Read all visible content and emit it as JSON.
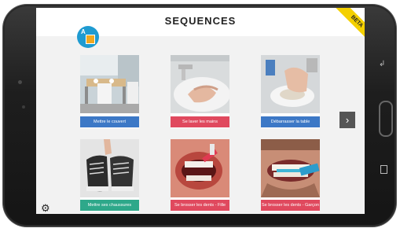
{
  "header": {
    "title": "SEQUENCES",
    "badge": "BETA",
    "logo_letter": "A"
  },
  "cards": [
    {
      "label": "Mettre le couvert",
      "color": "blue"
    },
    {
      "label": "Se laver les mains",
      "color": "red"
    },
    {
      "label": "Débarrasser la table",
      "color": "blue"
    },
    {
      "label": "Mettre ses chaussures",
      "color": "green"
    },
    {
      "label": "Se brosser les dents - Fille",
      "color": "red"
    },
    {
      "label": "Se brosser les dents - Garçon",
      "color": "red"
    }
  ],
  "colors": {
    "blue": "#3c78c6",
    "red": "#e0495e",
    "green": "#2ea88a",
    "badge": "#f4d000"
  },
  "icons": {
    "next": "chevron-right-icon",
    "settings": "gear-icon"
  }
}
